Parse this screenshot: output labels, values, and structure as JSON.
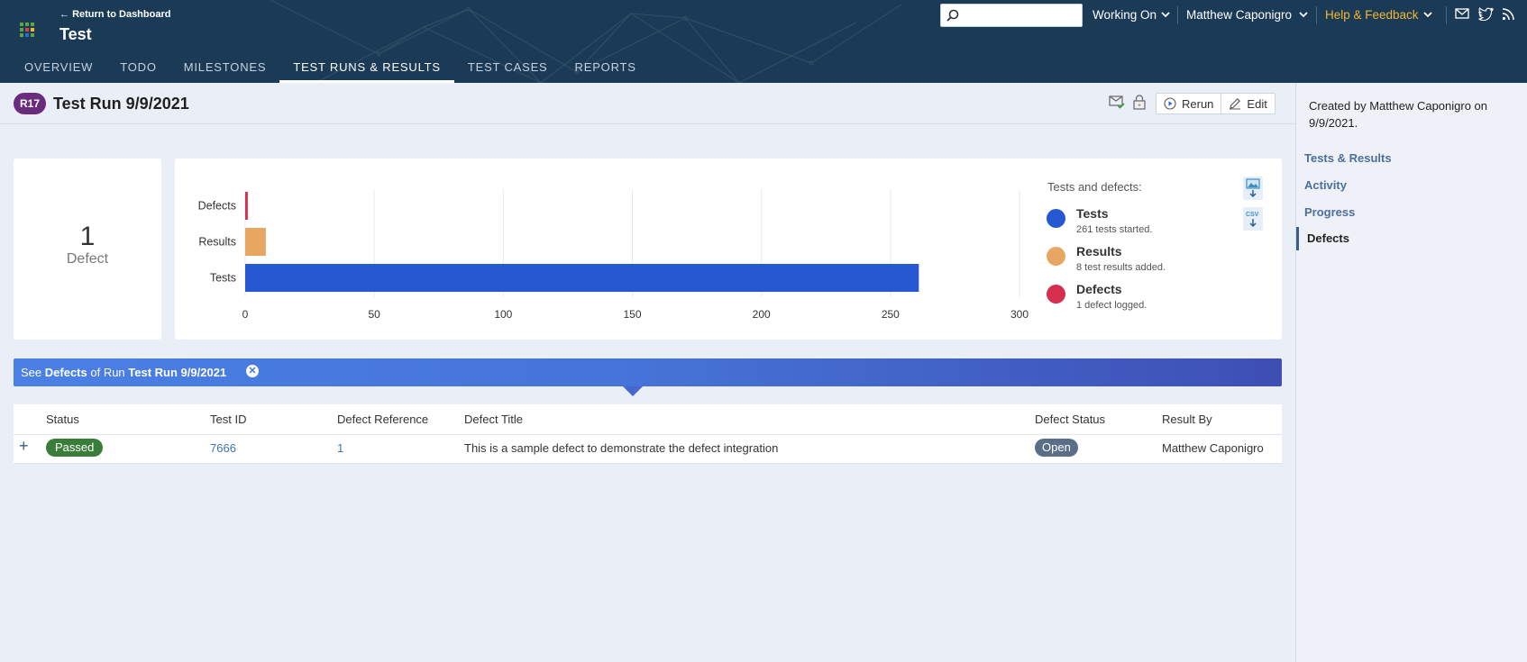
{
  "header": {
    "back_link": "Return to Dashboard",
    "project_title": "Test",
    "search": {
      "placeholder": "",
      "value": ""
    },
    "working_on": "Working On",
    "user_name": "Matthew Caponigro",
    "help": "Help & Feedback",
    "icons": [
      "mail-icon",
      "twitter-icon",
      "rss-icon"
    ],
    "tabs": [
      {
        "label": "OVERVIEW",
        "active": false
      },
      {
        "label": "TODO",
        "active": false
      },
      {
        "label": "MILESTONES",
        "active": false
      },
      {
        "label": "TEST RUNS & RESULTS",
        "active": true
      },
      {
        "label": "TEST CASES",
        "active": false
      },
      {
        "label": "REPORTS",
        "active": false
      }
    ],
    "colors": {
      "background": "#1b3a56",
      "help": "#f2b632"
    }
  },
  "run": {
    "badge": "R17",
    "title": "Test Run 9/9/2021",
    "rerun_label": "Rerun",
    "edit_label": "Edit",
    "badge_color": "#6a2b7e"
  },
  "summary": {
    "count": "1",
    "label": "Defect"
  },
  "chart_data": {
    "type": "bar",
    "orientation": "horizontal",
    "categories": [
      "Defects",
      "Results",
      "Tests"
    ],
    "values": [
      1,
      8,
      261
    ],
    "colors": [
      "#d62e4f",
      "#e8a663",
      "#2558d1"
    ],
    "xlim": [
      0,
      300
    ],
    "xticks": [
      0,
      50,
      100,
      150,
      200,
      250,
      300
    ],
    "grid": true,
    "legend_title": "Tests and defects:",
    "legend": [
      {
        "name": "Tests",
        "desc": "261 tests started.",
        "color": "#2558d1"
      },
      {
        "name": "Results",
        "desc": "8 test results added.",
        "color": "#e8a663"
      },
      {
        "name": "Defects",
        "desc": "1 defect logged.",
        "color": "#d62e4f"
      }
    ],
    "legend_placement": "right",
    "download_icons": [
      "image-download-icon",
      "csv-download-icon"
    ]
  },
  "filter": {
    "prefix": "See",
    "entity": "Defects",
    "middle": "of Run",
    "run_name": "Test Run 9/9/2021"
  },
  "table": {
    "columns": [
      "Status",
      "Test ID",
      "Defect Reference",
      "Defect Title",
      "Defect Status",
      "Result By"
    ],
    "rows": [
      {
        "status": "Passed",
        "test_id": "7666",
        "defect_ref": "1",
        "defect_title": "This is a sample defect to demonstrate the defect integration",
        "defect_status": "Open",
        "result_by": "Matthew Caponigro"
      }
    ]
  },
  "sidebar": {
    "created": "Created by Matthew Caponigro on 9/9/2021.",
    "links": [
      {
        "label": "Tests & Results",
        "active": false
      },
      {
        "label": "Activity",
        "active": false
      },
      {
        "label": "Progress",
        "active": false
      },
      {
        "label": "Defects",
        "active": true
      }
    ]
  }
}
